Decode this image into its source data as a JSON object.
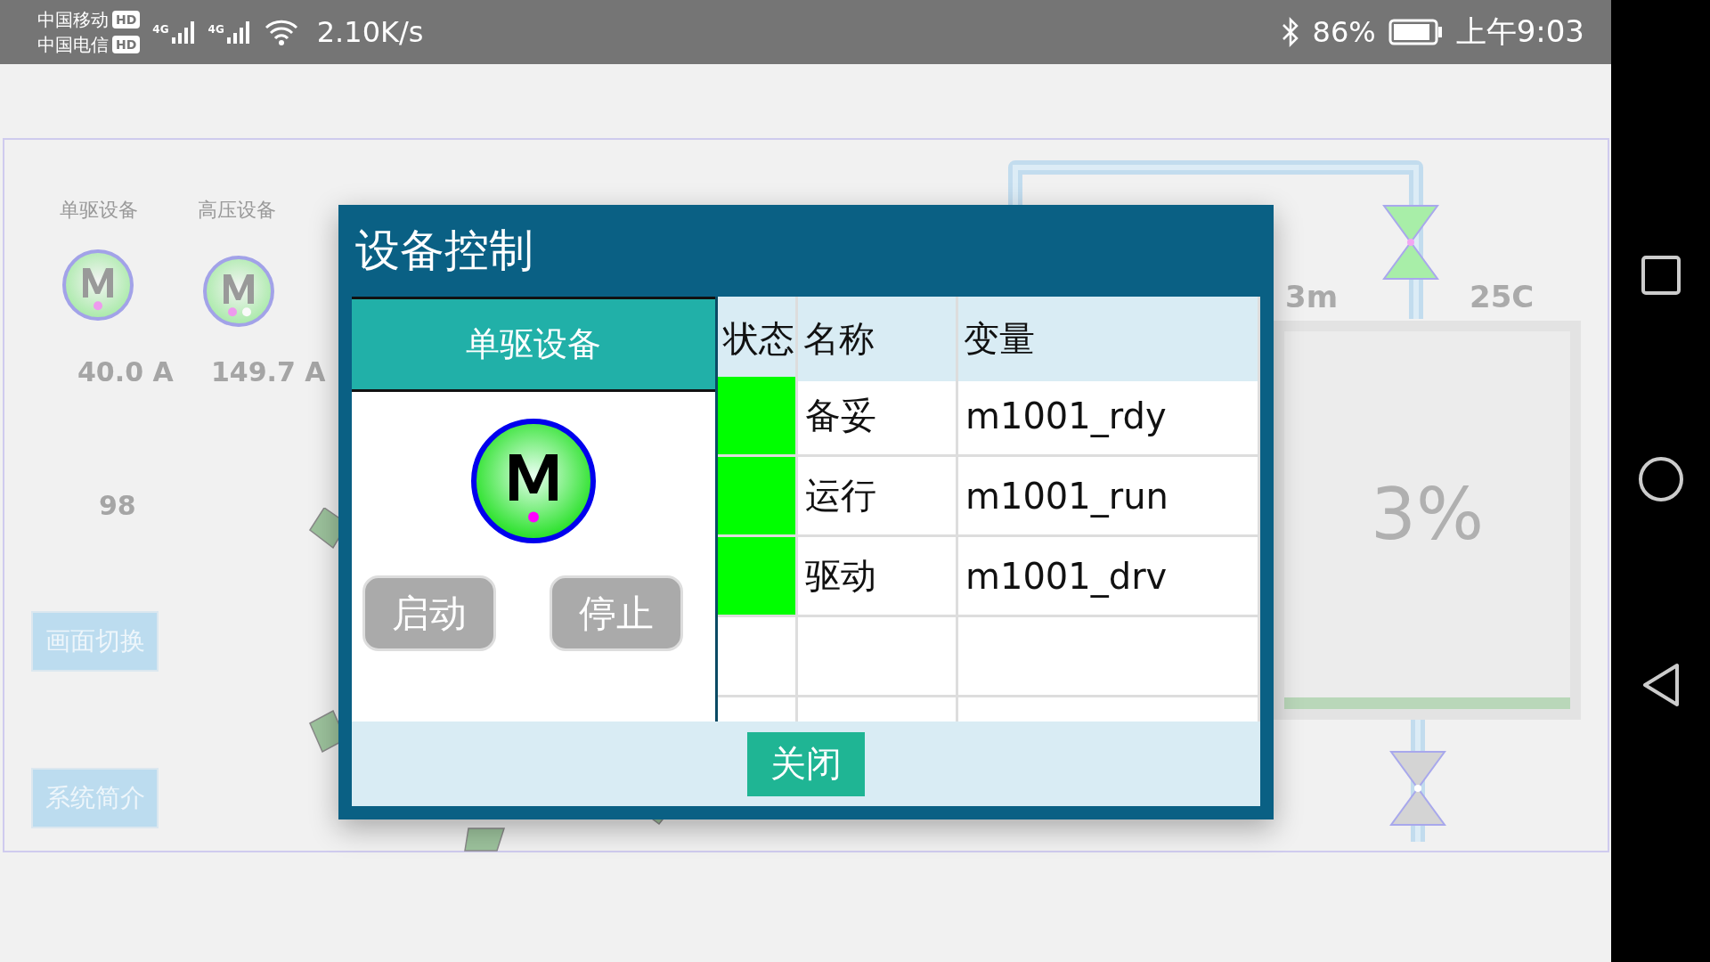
{
  "status_bar": {
    "carriers": [
      {
        "name": "中国移动",
        "badge": "HD"
      },
      {
        "name": "中国电信",
        "badge": "HD"
      }
    ],
    "networks": [
      "4G",
      "4G"
    ],
    "speed": "2.10K/s",
    "battery": "86%",
    "time": "上午9:03"
  },
  "background": {
    "devices": [
      {
        "label": "单驱设备",
        "current": "40.0 A"
      },
      {
        "label": "高压设备",
        "current": "149.7 A"
      }
    ],
    "reading": "98",
    "buttons": [
      "画面切换",
      "系统简介"
    ],
    "tank": {
      "height": "3m",
      "temperature": "25C",
      "percent": "3%",
      "level": 0.03
    }
  },
  "dialog": {
    "title": "设备控制",
    "device": "单驱设备",
    "buttons": [
      "启动",
      "停止"
    ],
    "columns": [
      "状态",
      "名称",
      "变量"
    ],
    "rows": [
      {
        "on": true,
        "name": "备妥",
        "variable": "m1001_rdy"
      },
      {
        "on": true,
        "name": "运行",
        "variable": "m1001_run"
      },
      {
        "on": true,
        "name": "驱动",
        "variable": "m1001_drv"
      }
    ],
    "close": "关闭"
  }
}
